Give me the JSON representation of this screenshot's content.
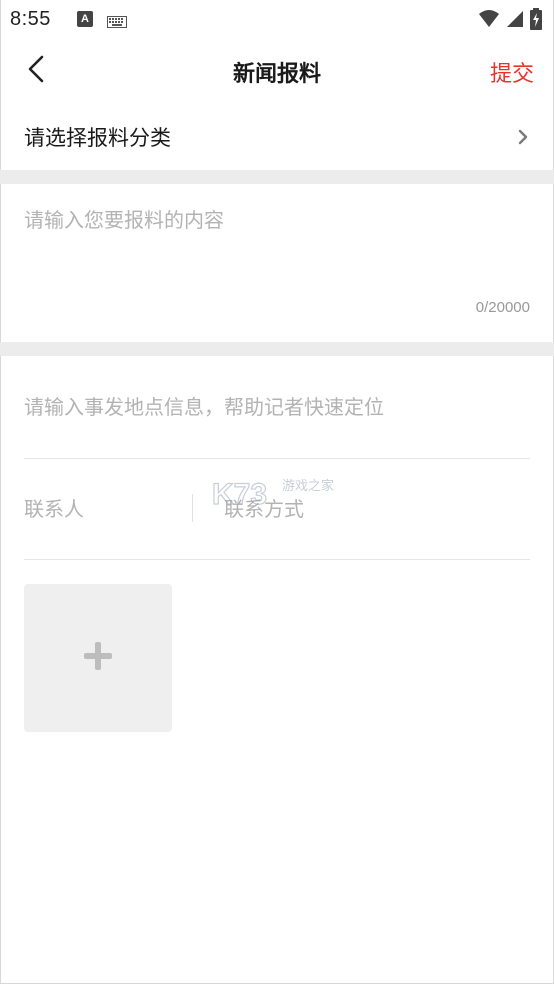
{
  "status_bar": {
    "time": "8:55",
    "a_badge": "A",
    "icons": [
      "keyboard-icon",
      "wifi-icon",
      "signal-icon",
      "battery-icon"
    ]
  },
  "header": {
    "title": "新闻报料",
    "submit_label": "提交"
  },
  "category": {
    "placeholder": "请选择报料分类"
  },
  "content": {
    "placeholder": "请输入您要报料的内容",
    "char_count": "0/20000"
  },
  "location": {
    "placeholder": "请输入事发地点信息，帮助记者快速定位"
  },
  "contact": {
    "name_placeholder": "联系人",
    "method_placeholder": "联系方式"
  },
  "watermark": {
    "text": "K73",
    "subtext": "游戏之家"
  },
  "colors": {
    "accent": "#e8332b",
    "placeholder": "#b3b3b3",
    "divider": "#ececec",
    "upload_bg": "#efefef"
  }
}
